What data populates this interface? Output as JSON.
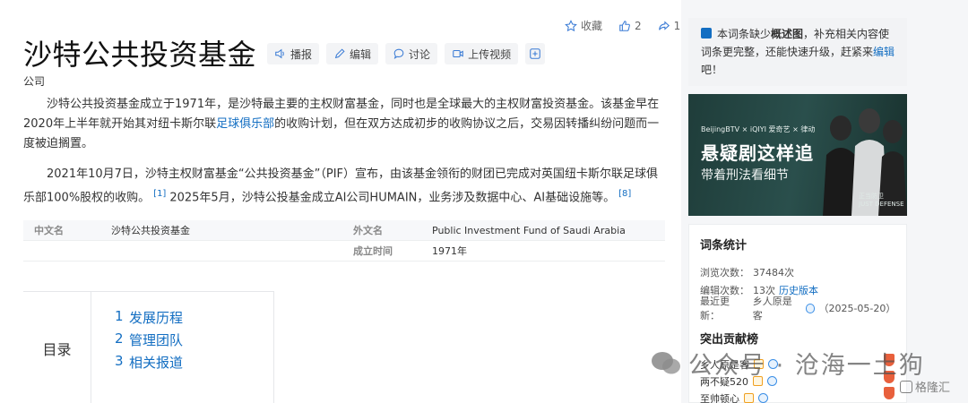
{
  "actions": {
    "favorite": "收藏",
    "like_count": "2",
    "share_count": "1"
  },
  "entry": {
    "title": "沙特公共投资基金",
    "subtitle": "公司",
    "tools": [
      "播报",
      "编辑",
      "讨论",
      "上传视频"
    ]
  },
  "paragraphs": {
    "p1_a": "沙特公共投资基金成立于1971年，是沙特最主要的主权财富基金，同时也是全球最大的主权财富投资基金。该基金早在2020年上半年就开始其对纽卡斯尔联",
    "p1_link": "足球俱乐部",
    "p1_b": "的收购计划，但在双方达成初步的收购协议之后，交易因转播纠纷问题而一度被迫搁置。",
    "p2_a": "2021年10月7日，沙特主权财富基金“公共投资基金”（PIF）宣布，由该基金领衔的财团已完成对英国纽卡斯尔联足球俱乐部100%股权的收购。",
    "p2_ref1": "[1]",
    "p2_b": "2025年5月，沙特公投基金成立AI公司HUMAIN，业务涉及数据中心、AI基础设施等。",
    "p2_ref2": "[8]"
  },
  "info_table": {
    "row1": {
      "k1": "中文名",
      "v1": "沙特公共投资基金",
      "k2": "外文名",
      "v2": "Public Investment Fund of Saudi Arabia"
    },
    "row2": {
      "k2": "成立时间",
      "v2": "1971年"
    }
  },
  "toc": {
    "label": "目录",
    "items": [
      {
        "num": "1",
        "text": "发展历程"
      },
      {
        "num": "2",
        "text": "管理团队"
      },
      {
        "num": "3",
        "text": "相关报道"
      }
    ]
  },
  "notice": {
    "a": "本词条缺少",
    "bold": "概述图",
    "b": "，补充相关内容使词条更完整，还能快速升级，赶紧来",
    "link": "编辑",
    "c": "吧！"
  },
  "ad": {
    "brands": "BeijingBTV × iQIYI 爱奇艺 × 律动",
    "headline": "悬疑剧这样追",
    "sub": "带着刑法看细节",
    "caption": "正当防卫\nJUST DEFENSE"
  },
  "stats": {
    "title": "词条统计",
    "views_label": "浏览次数：",
    "views": "37484次",
    "edits_label": "编辑次数：",
    "edits_count": "13次",
    "edits_link": "历史版本",
    "updated_label": "最近更新：",
    "updated_user": "乡人原是客",
    "updated_date": "（2025-05-20）",
    "contrib_title": "突出贡献榜",
    "contributors": [
      "乡人原是客",
      "两不疑520",
      "至帅顿心"
    ]
  },
  "watermark": {
    "main": "公众号 · 沧海一土狗",
    "corner": "格隆汇"
  },
  "colors": {
    "link": "#136ec2",
    "ad_bg": "#1f3d3a"
  }
}
